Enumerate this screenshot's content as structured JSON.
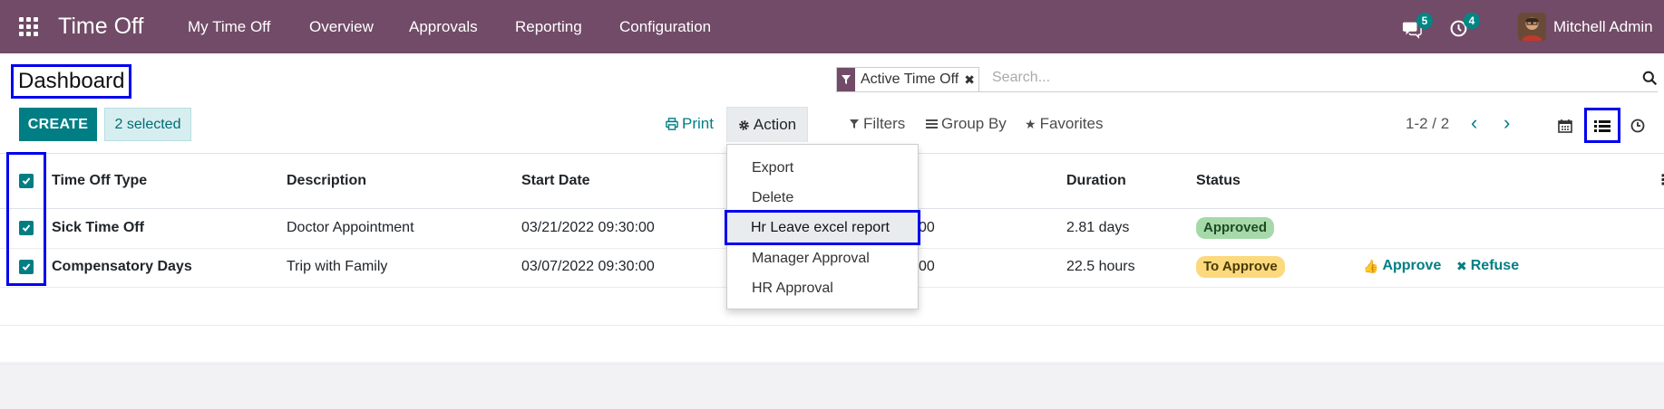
{
  "navbar": {
    "app_title": "Time Off",
    "menu": [
      "My Time Off",
      "Overview",
      "Approvals",
      "Reporting",
      "Configuration"
    ],
    "messages_count": "5",
    "activities_count": "4",
    "user_name": "Mitchell Admin",
    "background_color": "#714b67"
  },
  "page": {
    "title": "Dashboard"
  },
  "search": {
    "facet_value": "Active Time Off",
    "placeholder": "Search..."
  },
  "toolbar": {
    "create_label": "CREATE",
    "selected_label": "2 selected",
    "print_label": "Print",
    "action_label": "Action",
    "filters_label": "Filters",
    "group_by_label": "Group By",
    "favorites_label": "Favorites",
    "pager": "1-2 / 2"
  },
  "action_menu": {
    "items": [
      "Export",
      "Delete",
      "Hr Leave excel report",
      "Manager Approval",
      "HR Approval"
    ],
    "highlighted_item": "Hr Leave excel report"
  },
  "table": {
    "columns": [
      "Time Off Type",
      "Description",
      "Start Date",
      "Duration",
      "Status"
    ],
    "rows": [
      {
        "type": "Sick Time Off",
        "description": "Doctor Appointment",
        "start_date": "03/21/2022 09:30:00",
        "end_fragment": "00",
        "duration": "2.81 days",
        "status": "Approved",
        "checked": true
      },
      {
        "type": "Compensatory Days",
        "description": "Trip with Family",
        "start_date": "03/07/2022 09:30:00",
        "end_fragment": "00",
        "duration": "22.5 hours",
        "status": "To Approve",
        "approve_label": "Approve",
        "refuse_label": "Refuse",
        "checked": true
      }
    ]
  },
  "colors": {
    "primary": "#017e84",
    "approved_badge": "#a6d9a9",
    "to_approve_badge": "#fcd97c",
    "highlight_outline": "#0000ee"
  }
}
